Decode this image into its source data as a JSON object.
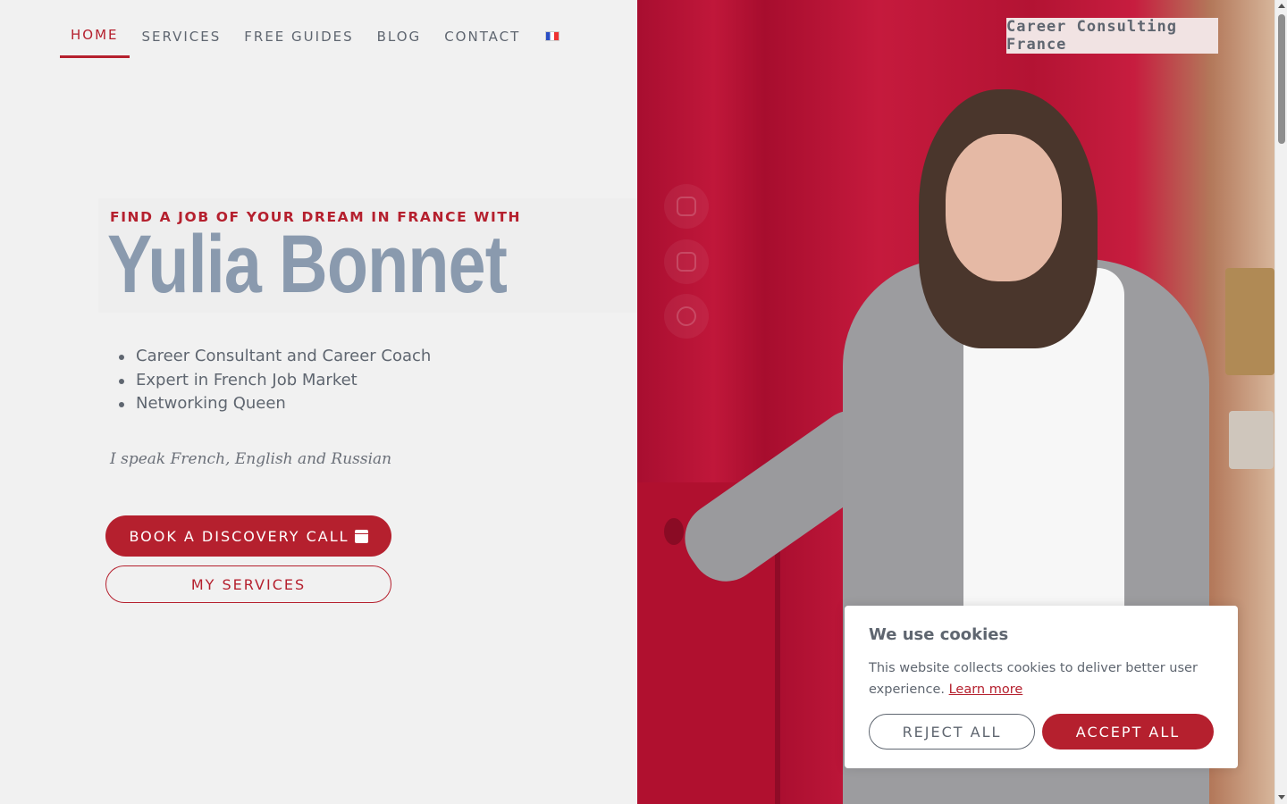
{
  "nav": {
    "items": [
      {
        "label": "HOME",
        "active": true
      },
      {
        "label": "SERVICES",
        "active": false
      },
      {
        "label": "FREE GUIDES",
        "active": false
      },
      {
        "label": "BLOG",
        "active": false
      },
      {
        "label": "CONTACT",
        "active": false
      }
    ],
    "language_icon": "french-flag-icon"
  },
  "hero": {
    "tagline": "FIND A JOB OF YOUR DREAM IN FRANCE WITH",
    "name": "Yulia Bonnet",
    "bullets": [
      "Career Consultant and Career Coach",
      "Expert in French Job Market",
      "Networking Queen"
    ],
    "languages": "I speak French, English and Russian",
    "primary_button": "BOOK A DISCOVERY CALL",
    "primary_button_icon": "calendar-icon",
    "secondary_button": "MY SERVICES"
  },
  "brand_label": "Career Consulting France",
  "social_icons": [
    "instagram-icon",
    "linkedin-icon",
    "facebook-icon"
  ],
  "cookie": {
    "title": "We use cookies",
    "text": "This website collects cookies to deliver better user experience.",
    "link": "Learn more",
    "reject": "REJECT ALL",
    "accept": "ACCEPT ALL"
  },
  "colors": {
    "accent": "#b5202e",
    "name_color": "#8a9aae",
    "text": "#5f6670",
    "background": "#f1f1f1"
  }
}
